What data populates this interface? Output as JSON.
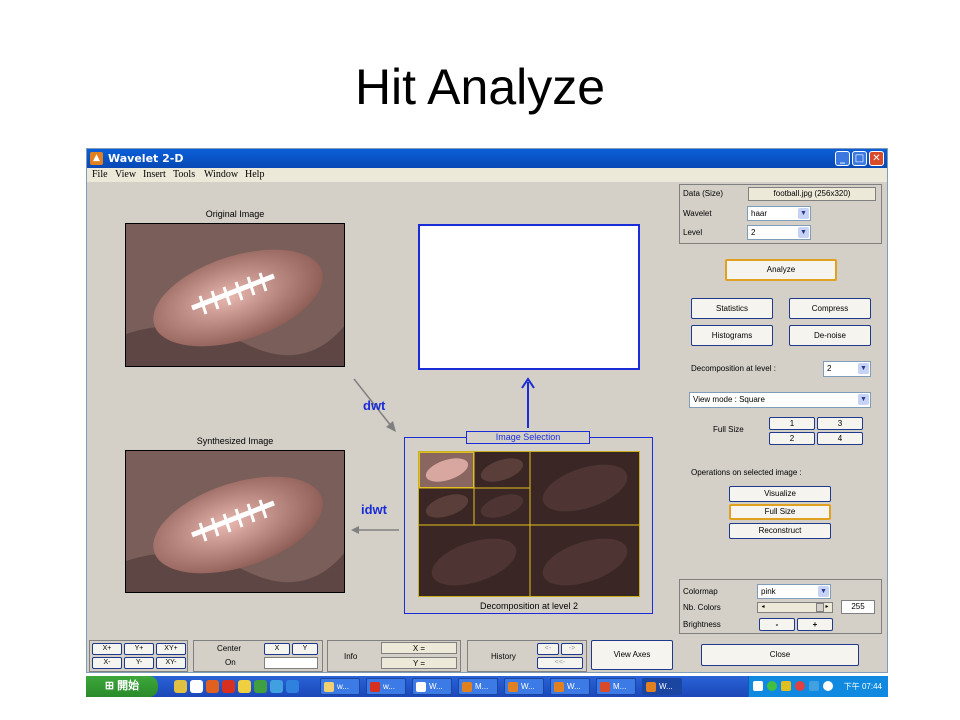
{
  "slide": {
    "title": "Hit Analyze"
  },
  "window": {
    "title": "Wavelet 2-D",
    "menu": [
      "File",
      "View",
      "Insert",
      "Tools",
      "Window",
      "Help"
    ]
  },
  "canvas": {
    "original_label": "Original Image",
    "synth_label": "Synthesized Image",
    "dwt_label": "dwt",
    "idwt_label": "idwt",
    "image_selection_title": "Image Selection",
    "decomp_caption": "Decomposition at level 2"
  },
  "right_panel": {
    "data_size_label": "Data  (Size)",
    "data_size_value": "football.jpg  (256x320)",
    "wavelet_label": "Wavelet",
    "wavelet_value": "haar",
    "level_label": "Level",
    "level_value": "2",
    "analyze_button": "Analyze",
    "statistics_button": "Statistics",
    "compress_button": "Compress",
    "histograms_button": "Histograms",
    "denoise_button": "De-noise",
    "decomp_level_label": "Decomposition at level :",
    "decomp_level_value": "2",
    "view_mode_value": "View mode : Square",
    "full_size_label": "Full Size",
    "full_size_1": "1",
    "full_size_2": "2",
    "full_size_3": "3",
    "full_size_4": "4",
    "operations_label": "Operations on selected image :",
    "visualize_button": "Visualize",
    "fullsize_button": "Full Size",
    "reconstruct_button": "Reconstruct",
    "colormap_label": "Colormap",
    "colormap_value": "pink",
    "nb_colors_label": "Nb. Colors",
    "nb_colors_value": "255",
    "brightness_label": "Brightness",
    "brightness_minus": "-",
    "brightness_plus": "+",
    "close_button": "Close"
  },
  "bottom_bar": {
    "xplus": "X+",
    "yplus": "Y+",
    "xyplus": "XY+",
    "xminus": "X-",
    "yminus": "Y-",
    "xyminus": "XY-",
    "center_label": "Center",
    "on_label": "On",
    "x_button": "X",
    "y_button": "Y",
    "info_label": "Info",
    "x_eq": "X =",
    "y_eq": "Y =",
    "history_label": "History",
    "hist_back": "<-",
    "hist_fwd": "->",
    "hist_first": "<<-",
    "view_axes_button": "View Axes"
  },
  "taskbar": {
    "start_label": "開始",
    "items": [
      "w...",
      "w...",
      "W...",
      "M...",
      "W...",
      "W...",
      "M...",
      "W..."
    ],
    "clock": "下午 07:44"
  },
  "colors": {
    "accent_blue": "#1a2cd8",
    "title_bar": "#0a5fd8",
    "window_bg": "#d4d0c8",
    "highlight": "#e0a020"
  }
}
